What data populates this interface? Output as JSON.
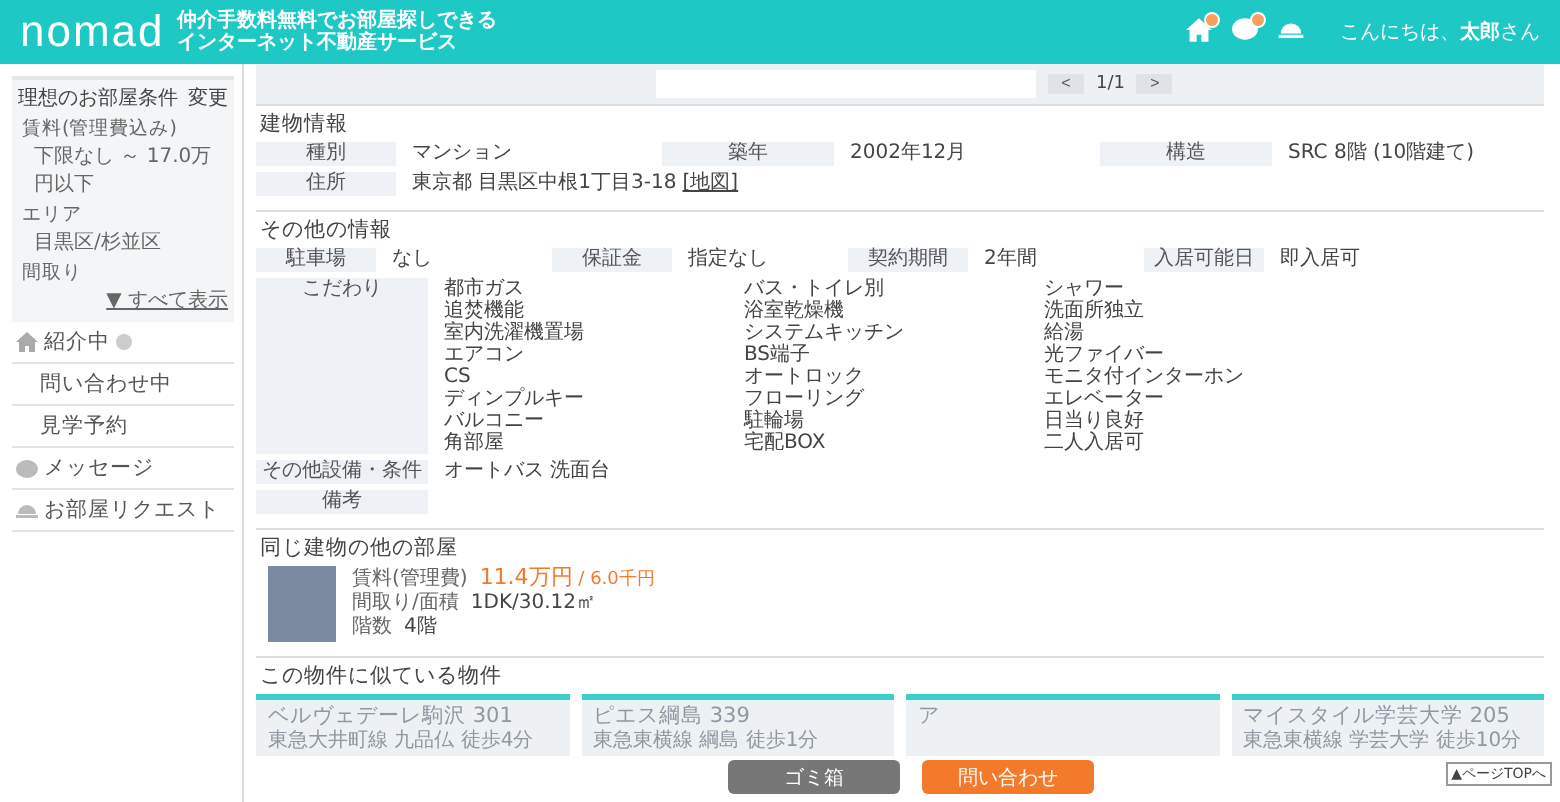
{
  "header": {
    "logo": "nomad",
    "tagline": [
      "仲介手数料無料でお部屋探しできる",
      "インターネット不動産サービス"
    ],
    "greeting": "こんにちは、**太郎**さん"
  },
  "sidebar": {
    "conditions": {
      "title": "理想のお部屋条件",
      "change": "変更",
      "fields": [
        {
          "label": "賃料(管理費込み)",
          "value": "下限なし ～ 17.0万円以下"
        },
        {
          "label": "エリア",
          "value": "目黒区/杉並区"
        },
        {
          "label": "間取り"
        }
      ],
      "show_all": "▼ すべて表示"
    },
    "nav": [
      {
        "label": "紹介中",
        "kind": "home",
        "help": true
      },
      {
        "label": "問い合わせ中",
        "kind": "sub",
        "help": false
      },
      {
        "label": "見学予約",
        "kind": "sub",
        "help": false
      },
      {
        "label": "メッセージ",
        "kind": "message",
        "help": false
      },
      {
        "label": "お部屋リクエスト",
        "kind": "request",
        "help": false
      }
    ]
  },
  "pager": {
    "prev": "<",
    "page": "1/1",
    "next": ">"
  },
  "building_info": {
    "title": "建物情報",
    "rows": [
      [
        {
          "label": "種別",
          "value": "マンション"
        },
        {
          "label": "築年",
          "value": "2002年12月"
        },
        {
          "label": "構造",
          "value": "SRC 8階 (10階建て)"
        }
      ],
      [
        {
          "label": "住所",
          "value": "東京都 目黒区中根1丁目3-18",
          "link": "[地図]"
        }
      ]
    ]
  },
  "other_info": {
    "title": "その他の情報",
    "fields": [
      {
        "label": "駐車場",
        "value": "なし"
      },
      {
        "label": "保証金",
        "value": "指定なし"
      },
      {
        "label": "契約期間",
        "value": "2年間"
      },
      {
        "label": "入居可能日",
        "value": "即入居可"
      }
    ],
    "features": {
      "label": "こだわり",
      "columns": [
        [
          "都市ガス",
          "追焚機能",
          "室内洗濯機置場",
          "エアコン",
          "CS",
          "ディンプルキー",
          "バルコニー",
          "角部屋"
        ],
        [
          "バス・トイレ別",
          "浴室乾燥機",
          "システムキッチン",
          "BS端子",
          "オートロック",
          "フローリング",
          "駐輪場",
          "宅配BOX"
        ],
        [
          "シャワー",
          "洗面所独立",
          "給湯",
          "光ファイバー",
          "モニタ付インターホン",
          "エレベーター",
          "日当り良好",
          "二人入居可"
        ]
      ]
    },
    "extra": [
      {
        "label": "その他設備・条件",
        "value": "オートバス 洗面台"
      },
      {
        "label": "備考"
      }
    ]
  },
  "same_building": {
    "title": "同じ建物の他の部屋",
    "room": {
      "rent_label": "賃料(管理費)",
      "rent": "11.4万円",
      "fee": " / 6.0千円",
      "layout_label": "間取り/面積",
      "layout": "1DK/30.12㎡",
      "floor_label": "階数",
      "floor": "4階"
    }
  },
  "similar": {
    "title": "この物件に似ている物件",
    "cards": [
      {
        "title": "ベルヴェデーレ駒沢 301",
        "line": "東急大井町線 九品仏 徒歩4分"
      },
      {
        "title": "ピエス綱島 339",
        "line": "東急東横線 綱島 徒歩1分"
      },
      {
        "title": "ア"
      },
      {
        "title": "マイスタイル学芸大学 205",
        "line": "東急東横線 学芸大学 徒歩10分"
      }
    ]
  },
  "actions": {
    "trash": "ゴミ箱",
    "inquiry": "問い合わせ",
    "page_top": "▲ページTOPへ"
  }
}
